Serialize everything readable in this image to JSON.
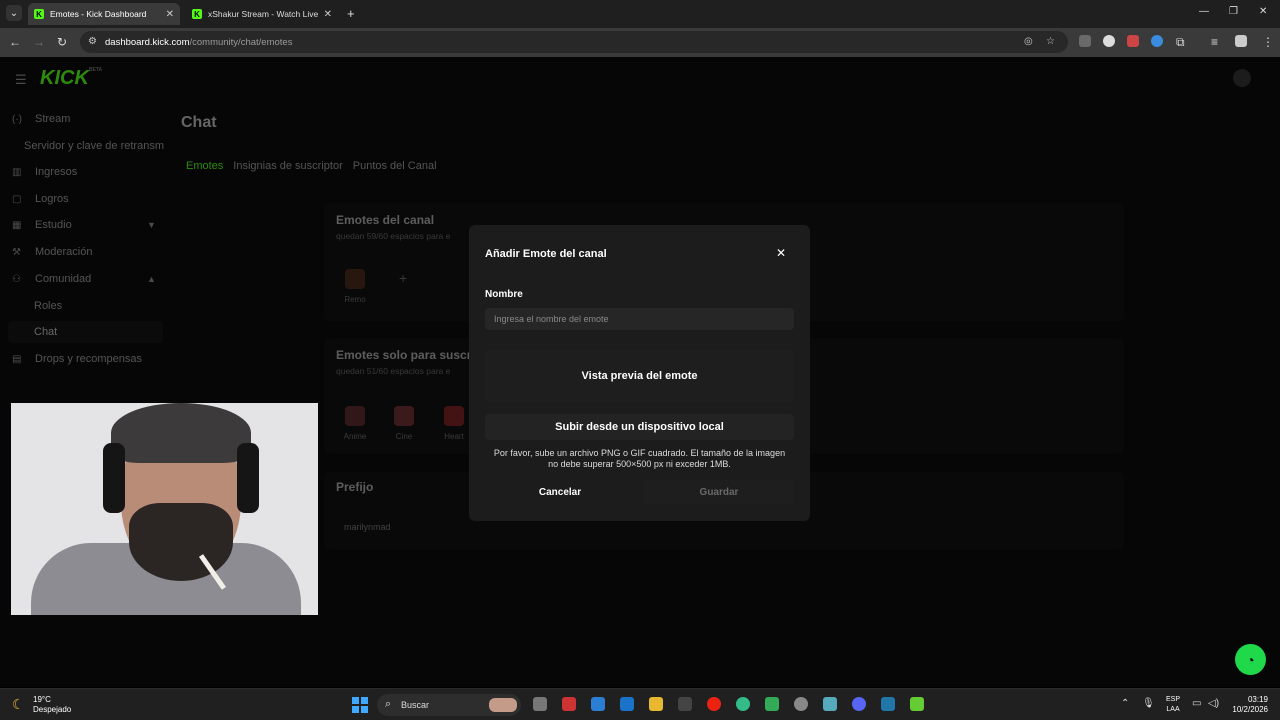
{
  "browser": {
    "tabs": [
      {
        "title": "Emotes - Kick Dashboard",
        "active": true
      },
      {
        "title": "xShakur Stream - Watch Live on",
        "active": false
      }
    ],
    "url_host": "dashboard.kick.com",
    "url_path": "/community/chat/emotes"
  },
  "kick": {
    "logo": "KICK",
    "logo_badge": "BETA",
    "sidebar": {
      "stream": "Stream",
      "server": "Servidor y clave de retransm",
      "ingresos": "Ingresos",
      "logros": "Logros",
      "estudio": "Estudio",
      "moderacion": "Moderación",
      "comunidad": "Comunidad",
      "roles": "Roles",
      "chat": "Chat",
      "drops": "Drops y recompensas"
    },
    "page_title": "Chat",
    "tabs": [
      "Emotes",
      "Insignias de suscriptor",
      "Puntos del Canal"
    ],
    "channel_emotes": {
      "title": "Emotes del canal",
      "subtitle": "quedan 59/60 espacios para e",
      "items": [
        "Remo"
      ]
    },
    "sub_emotes": {
      "title": "Emotes solo para suscr",
      "subtitle": "quedan 51/60 espacios para e",
      "items": [
        "Anime",
        "Cine",
        "Heart"
      ]
    },
    "prefix": {
      "title": "Prefijo",
      "value": "marilynmad"
    }
  },
  "modal": {
    "title": "Añadir Emote del canal",
    "close": "✕",
    "name_label": "Nombre",
    "name_placeholder": "Ingresa el nombre del emote",
    "preview": "Vista previa del emote",
    "upload": "Subir desde un dispositivo local",
    "help": "Por favor, sube un archivo PNG o GIF cuadrado. El tamaño de la imagen no debe superar 500×500 px ni exceder 1MB.",
    "cancel": "Cancelar",
    "save": "Guardar"
  },
  "taskbar": {
    "temp": "19°C",
    "weather": "Despejado",
    "search": "Buscar",
    "lang1": "ESP",
    "lang2": "LAA",
    "time": "03:19",
    "date": "10/2/2026"
  },
  "colors": {
    "accent": "#53fc18",
    "modal_bg": "#1c1c1c"
  }
}
